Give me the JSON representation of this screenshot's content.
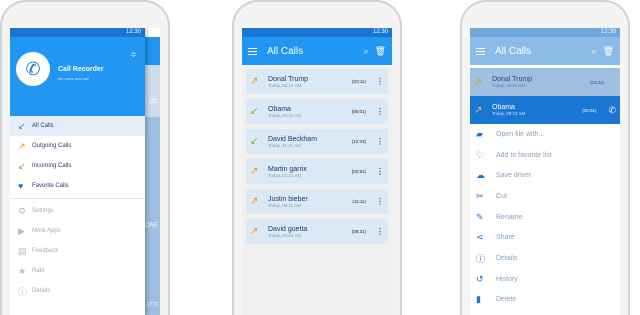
{
  "status_time": "12:30",
  "phone1": {
    "app_name": "Call Recorder",
    "tagline": "rec more any call",
    "drawer_items": [
      {
        "label": "All Calls"
      },
      {
        "label": "Outgoing Calls"
      },
      {
        "label": "Incoming Calls"
      },
      {
        "label": "Favorite Calls"
      },
      {
        "label": "Settings"
      },
      {
        "label": "More Apps"
      },
      {
        "label": "Feedback"
      },
      {
        "label": "Rate"
      },
      {
        "label": "Details"
      }
    ],
    "behind_text": {
      "qd": "QD",
      "more": "MORE",
      "num": "1772"
    }
  },
  "phone2": {
    "title": "All Calls",
    "calls": [
      {
        "name": "Donal Trump",
        "date": "Today, 03:16 AM",
        "duration": "(03:11)",
        "dir": "out"
      },
      {
        "name": "Obama",
        "date": "Today, 09:23 AM",
        "duration": "(05:01)",
        "dir": "in"
      },
      {
        "name": "David Beckham",
        "date": "Today, 11:21 AM",
        "duration": "(12:33)",
        "dir": "in"
      },
      {
        "name": "Martin garrix",
        "date": "Today, 01:21 AM",
        "duration": "(02:51)",
        "dir": "out"
      },
      {
        "name": "Justin bieber",
        "date": "Today, 08:11 AM",
        "duration": "(11:11)",
        "dir": "out"
      },
      {
        "name": "David guetta",
        "date": "Today, 09:21 AM",
        "duration": "(08:31)",
        "dir": "out"
      }
    ]
  },
  "phone3": {
    "title": "All Calls",
    "top_row": {
      "name": "Donal Trump",
      "date": "Today, 10:11 AM",
      "duration": "(03:11)"
    },
    "selected_row": {
      "name": "Obama",
      "date": "Today, 09:23 AM",
      "duration": "(05:01)"
    },
    "menu": [
      {
        "label": "Open file with...",
        "icon": "folder-icon"
      },
      {
        "label": "Add to favorite list",
        "icon": "heart-icon"
      },
      {
        "label": "Save driver",
        "icon": "cloud-upload-icon"
      },
      {
        "label": "Cut",
        "icon": "scissors-icon"
      },
      {
        "label": "Rename",
        "icon": "rename-icon"
      },
      {
        "label": "Share",
        "icon": "share-icon"
      },
      {
        "label": "Details",
        "icon": "info-icon"
      },
      {
        "label": "History",
        "icon": "history-icon"
      },
      {
        "label": "Delete",
        "icon": "trash-icon"
      }
    ]
  }
}
